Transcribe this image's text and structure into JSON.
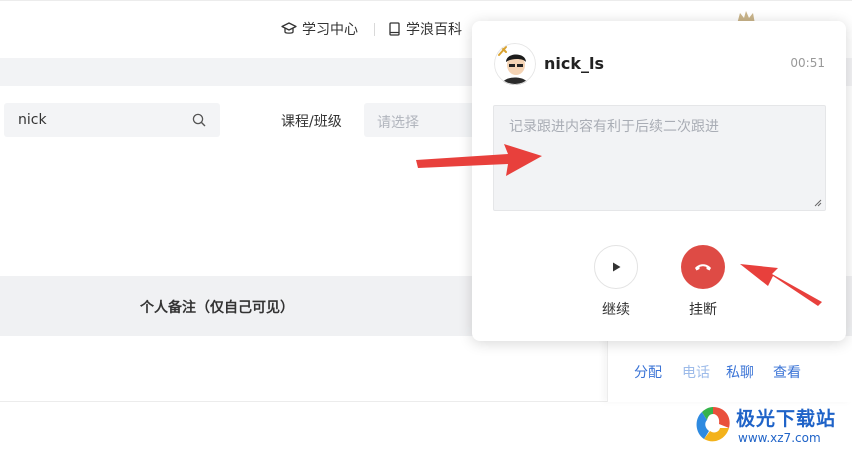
{
  "nav": {
    "learning_center": "学习中心",
    "encyclopedia": "学浪百科"
  },
  "filters": {
    "search_value": "nick",
    "course_label": "课程/班级",
    "course_placeholder": "请选择"
  },
  "table": {
    "column_note": "个人备注（仅自己可见）",
    "actions": {
      "assign": "分配",
      "phone": "电话",
      "chat": "私聊",
      "view": "查看"
    }
  },
  "call": {
    "caller_name": "nick_ls",
    "duration": "00:51",
    "notes_placeholder": "记录跟进内容有利于后续二次跟进",
    "resume_label": "继续",
    "hangup_label": "挂断",
    "hangup_color": "#de4b45"
  },
  "watermark": {
    "brand": "极光下载站",
    "url": "www.xz7.com"
  },
  "colors": {
    "link": "#3b74d6",
    "annotation_arrow": "#e8403c"
  }
}
